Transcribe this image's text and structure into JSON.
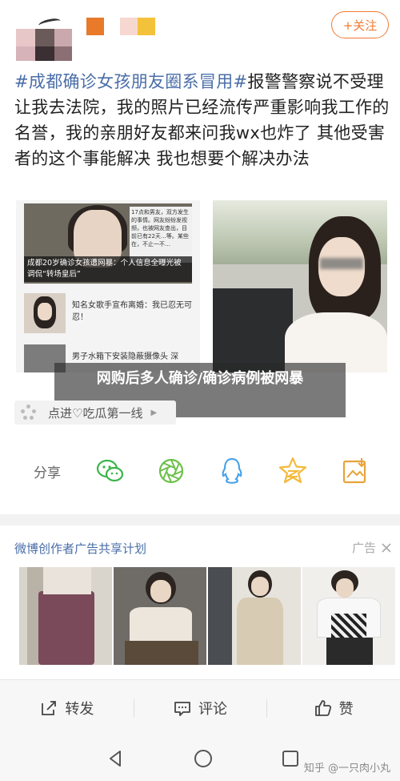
{
  "header": {
    "follow_label": "+关注",
    "avatar_colors": [
      "#e8c7c9",
      "#6b5a5a",
      "#3a2f32",
      "#c9a9ad",
      "#8b6f74",
      "#d6b3b8"
    ],
    "badge_colors": [
      "#e87a2a",
      "#f6d8d0",
      "#f4c23a"
    ]
  },
  "post": {
    "hashtag": "#成都确诊女孩朋友圈系冒用#",
    "body": "报警警察说不受理 让我去法院，我的照片已经流传严重影响我工作的名誉，我的亲朋好友都来问我wx也炸了 其他受害者的这个事能解决 我也想要个解决办法"
  },
  "left_image": {
    "news_caption": "成都20岁确诊女孩遭网暴：个人信息全曝光被调侃“转场皇后”",
    "news_snippet": "17点和男友，双方发生的事情。网友纷纷发视频，也被网友查出，目前已有22天…等。某些在，不止一不…",
    "row1_text": "知名女歌手宣布离婚：我已忍无可忍！",
    "row2_text": "男子水箱下安装隐蔽摄像头 深"
  },
  "overlay": {
    "title": "网购后多人确诊/确诊病例被网暴"
  },
  "chip": {
    "label": "点进♡吃瓜第一线",
    "arrow": "▶"
  },
  "share": {
    "label": "分享",
    "icons": [
      "wechat-icon",
      "moments-icon",
      "qq-icon",
      "qzone-icon",
      "save-image-icon"
    ],
    "colors": {
      "wechat": "#3bb54a",
      "moments": "#6cc04a",
      "qq": "#4aa3e8",
      "qzone": "#f4b93a",
      "save": "#e8a33a"
    }
  },
  "ad": {
    "title": "微博创作者广告共享计划",
    "tag": "广告"
  },
  "actions": {
    "repost": "转发",
    "comment": "评论",
    "like": "赞"
  },
  "footer": {
    "credit": "知乎 @一只肉小丸"
  },
  "colors": {
    "accent": "#f07c33",
    "link": "#4a6ea8"
  }
}
